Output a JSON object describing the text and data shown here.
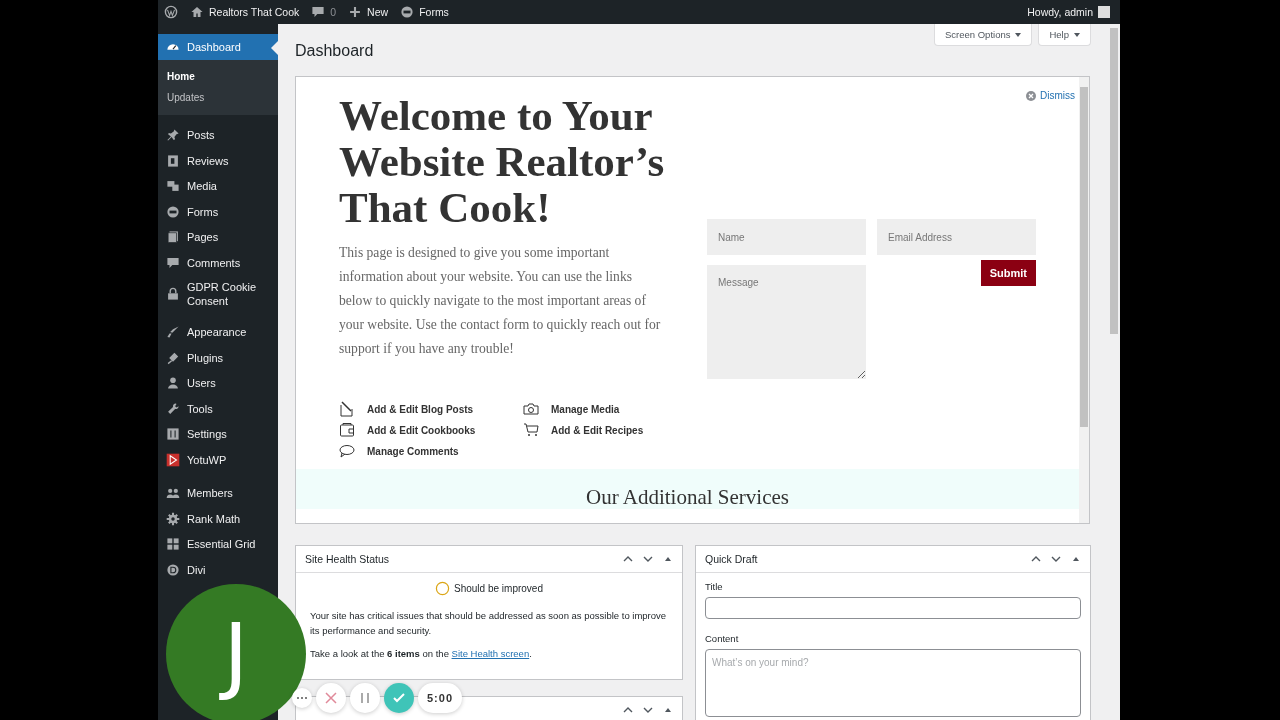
{
  "admin_bar": {
    "site_name": "Realtors That Cook",
    "comments_count": "0",
    "new_label": "New",
    "forms_label": "Forms",
    "greeting": "Howdy, admin"
  },
  "sidebar": {
    "groups": [
      {
        "items": [
          {
            "label": "Dashboard",
            "selected": true,
            "children": [
              {
                "label": "Home",
                "selected": true
              },
              {
                "label": "Updates",
                "selected": false
              }
            ]
          }
        ]
      },
      {
        "items": [
          {
            "label": "Posts",
            "selected": false
          },
          {
            "label": "Reviews",
            "selected": false
          },
          {
            "label": "Media",
            "selected": false
          },
          {
            "label": "Forms",
            "selected": false
          },
          {
            "label": "Pages",
            "selected": false
          },
          {
            "label": "Comments",
            "selected": false
          },
          {
            "label": "GDPR Cookie Consent",
            "selected": false
          }
        ]
      },
      {
        "items": [
          {
            "label": "Appearance",
            "selected": false
          },
          {
            "label": "Plugins",
            "selected": false
          },
          {
            "label": "Users",
            "selected": false
          },
          {
            "label": "Tools",
            "selected": false
          },
          {
            "label": "Settings",
            "selected": false
          },
          {
            "label": "YotuWP",
            "selected": false
          }
        ]
      },
      {
        "items": [
          {
            "label": "Members",
            "selected": false
          },
          {
            "label": "Rank Math",
            "selected": false
          },
          {
            "label": "Essential Grid",
            "selected": false
          },
          {
            "label": "Divi",
            "selected": false
          }
        ]
      }
    ]
  },
  "header": {
    "page_title": "Dashboard",
    "screen_options": "Screen Options",
    "help": "Help"
  },
  "welcome": {
    "dismiss": "Dismiss",
    "heading": "Welcome to Your Website Realtor’s That Cook!",
    "intro": "This page is designed to give you some important information about your website. You can use the links below to quickly navigate to the most important areas of your website. Use the contact form to quickly reach out for support if you have any trouble!",
    "links": [
      "Add & Edit Blog Posts",
      "Manage Media",
      "Add & Edit Cookbooks",
      "Add & Edit Recipes",
      "Manage Comments"
    ],
    "form": {
      "fields": [
        {
          "kind": "input",
          "placeholder": "Name"
        },
        {
          "kind": "input",
          "placeholder": "Email Address"
        },
        {
          "kind": "textarea",
          "placeholder": "Message"
        }
      ],
      "submit": "Submit"
    },
    "services_heading": "Our Additional Services"
  },
  "site_health": {
    "title": "Site Health Status",
    "status": "Should be improved",
    "text": "Your site has critical issues that should be addressed as soon as possible to improve its performance and security.",
    "action": "Take a look at the **6 items** on the ",
    "link": "Site Health screen",
    "after": "."
  },
  "quick_draft": {
    "title": "Quick Draft",
    "title_label": "Title",
    "content_label": "Content",
    "content_placeholder": "What’s on your mind?"
  },
  "recorder": {
    "initial": "J",
    "timer": "5:00"
  }
}
